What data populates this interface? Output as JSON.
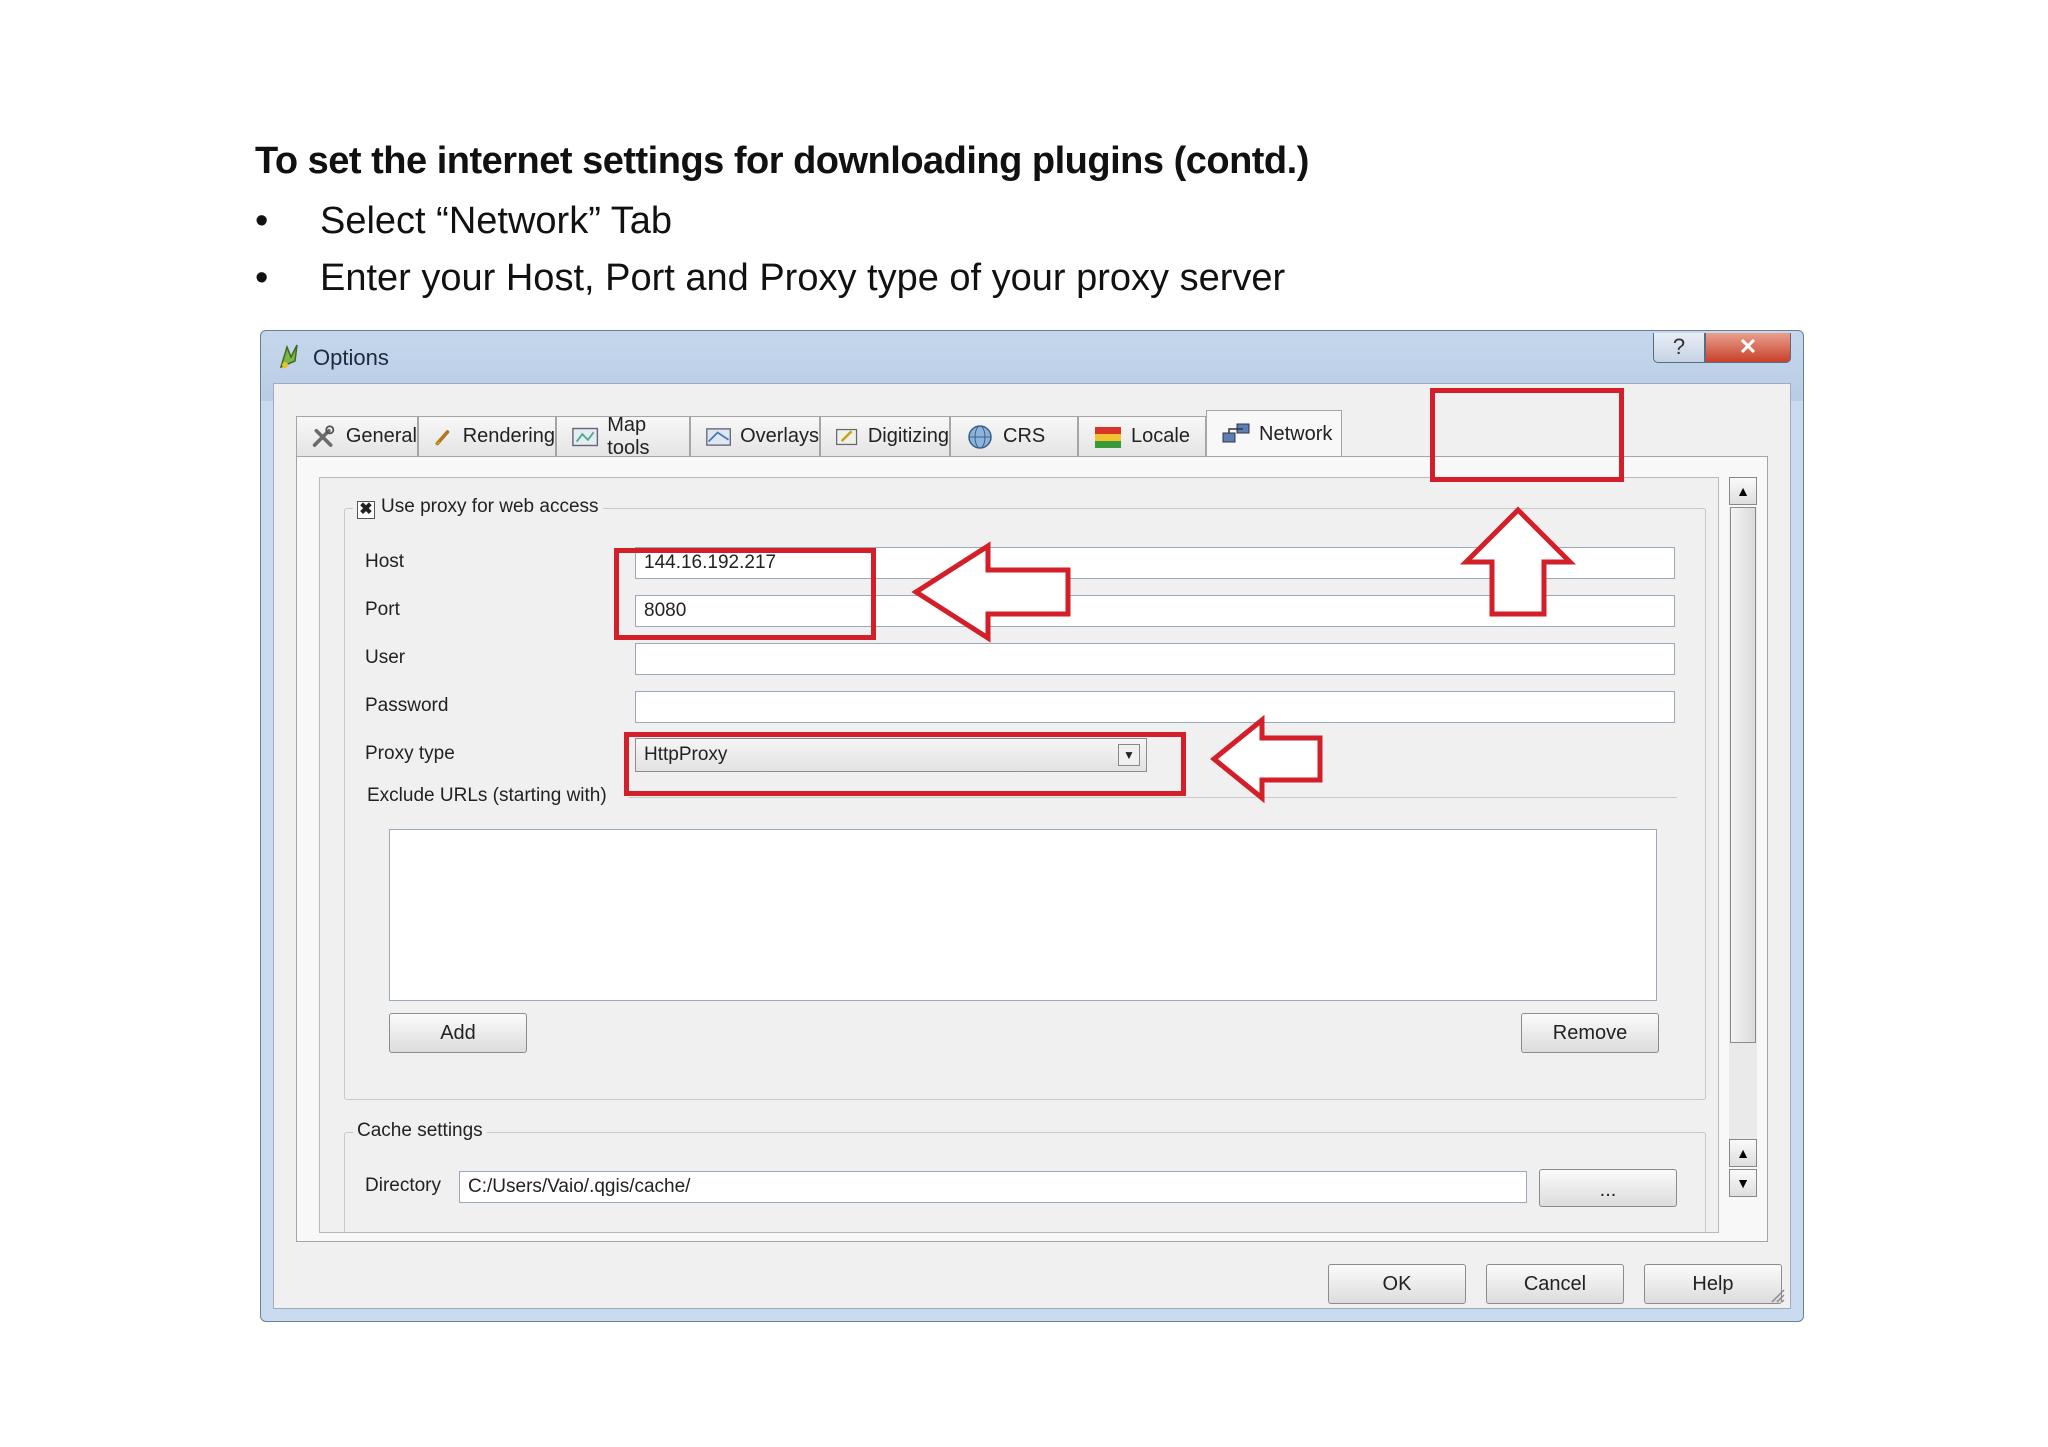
{
  "slide": {
    "heading": "To set the internet settings for downloading plugins (contd.)",
    "bullet_symbol": "•",
    "bullets": [
      "Select “Network” Tab",
      "Enter your Host, Port and Proxy type of your proxy server"
    ]
  },
  "dialog": {
    "title": "Options",
    "help_label": "?",
    "close_label": "✕",
    "tabs": [
      {
        "label": "General",
        "icon": "tools-icon"
      },
      {
        "label": "Rendering",
        "icon": "brush-icon"
      },
      {
        "label": "Map tools",
        "icon": "map-tools-icon"
      },
      {
        "label": "Overlays",
        "icon": "overlays-icon"
      },
      {
        "label": "Digitizing",
        "icon": "digitizing-icon"
      },
      {
        "label": "CRS",
        "icon": "globe-icon"
      },
      {
        "label": "Locale",
        "icon": "flag-icon"
      },
      {
        "label": "Network",
        "icon": "network-icon"
      }
    ],
    "active_tab": "Network",
    "proxy": {
      "checkbox_label": "Use proxy for web access",
      "checked": true,
      "check_mark": "✖",
      "host_label": "Host",
      "host_value": "144.16.192.217",
      "port_label": "Port",
      "port_value": "8080",
      "user_label": "User",
      "user_value": "",
      "password_label": "Password",
      "password_value": "",
      "proxy_type_label": "Proxy type",
      "proxy_type_value": "HttpProxy",
      "exclude_label": "Exclude URLs (starting with)",
      "add_label": "Add",
      "remove_label": "Remove"
    },
    "cache": {
      "legend": "Cache settings",
      "directory_label": "Directory",
      "directory_value": "C:/Users/Vaio/.qgis/cache/",
      "browse_label": "..."
    },
    "buttons": {
      "ok": "OK",
      "cancel": "Cancel",
      "help": "Help"
    }
  },
  "colors": {
    "annotation_red": "#d21f2a",
    "title_gradient": "#b8cde6"
  }
}
